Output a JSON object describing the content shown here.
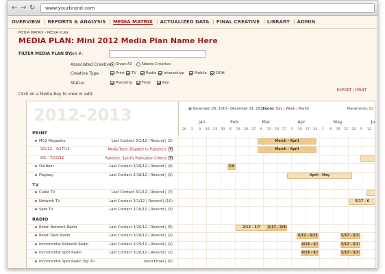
{
  "browser": {
    "url": "www.yourbrand.com",
    "back": "←",
    "forward": "→",
    "reload": "↻"
  },
  "nav": {
    "items": [
      "OVERVIEW",
      "REPORTS & ANALYSIS",
      "MEDIA MATRIX",
      "ACTUALIZED DATA",
      "FINAL CREATIVE",
      "LIBRARY",
      "ADMIN"
    ],
    "active": "MEDIA MATRIX"
  },
  "breadcrumb": "MEDIA MATRIX  ›  MEDIA PLAN",
  "title": "MEDIA PLAN: Mini 2012 Media Plan Name Here",
  "filter": {
    "label": "FILTER MEDIA PLAN BY:",
    "job_label": "Job #:",
    "job_value": "",
    "assoc_label": "Associated Creative:",
    "assoc_options": [
      {
        "label": "Show All",
        "selected": true
      },
      {
        "label": "Needs Creative",
        "selected": false
      }
    ],
    "type_label": "Creative Type:",
    "type_options": [
      {
        "label": "Print",
        "checked": true
      },
      {
        "label": "TV",
        "checked": true
      },
      {
        "label": "Radio",
        "checked": true
      },
      {
        "label": "Interactive",
        "checked": true
      },
      {
        "label": "Mobile",
        "checked": true
      },
      {
        "label": "OOH",
        "checked": true
      }
    ],
    "status_label": "Status:",
    "status_options": [
      {
        "label": "Planning",
        "checked": true
      },
      {
        "label": "Final",
        "checked": true
      },
      {
        "label": "Run",
        "checked": true
      }
    ]
  },
  "hint": "Click on a Media Buy to view or edit.",
  "actions": {
    "export": "EXPORT",
    "sep": "|",
    "print": "PRINT"
  },
  "plan": {
    "year": "2012-2013",
    "date_range": "December 26, 2010 - December 31, 2011",
    "zoom_label": "Zoom:",
    "zoom_options": [
      "Day",
      "Week",
      "Month"
    ],
    "placements_label": "Placements:",
    "months": [
      "Jan",
      "Feb",
      "Mar",
      "Apr",
      "May",
      "Jun"
    ],
    "weeks": [
      "26",
      "2",
      "9",
      "16",
      "23",
      "30",
      "6",
      "13",
      "20",
      "27",
      "6",
      "13",
      "20",
      "27",
      "3",
      "10",
      "17",
      "24",
      "1",
      "8",
      "15",
      "22",
      "29",
      "5",
      "12"
    ],
    "sections": [
      {
        "name": "PRINT",
        "rows": [
          {
            "name": "MC2 Magazine",
            "last": "Last Contact 3/1/12  |  Resend  |  (2)",
            "bars": [
              {
                "label": "March - April",
                "start": 0.4,
                "end": 0.7,
                "dark": true
              }
            ]
          },
          {
            "name": "3/1/12 - 4/27/12",
            "sub": true,
            "task": "Media Team: Dispatch to Publishers",
            "bars": [
              {
                "label": "March - April",
                "start": 0.4,
                "end": 0.7,
                "dark": true
              }
            ]
          },
          {
            "name": "6/1 - 7/21/12",
            "sub": true,
            "task": "Publisher: Specify Publication Criteria",
            "bars": [
              {
                "label": "",
                "start": 0.92,
                "end": 1.0,
                "dark": false
              }
            ]
          },
          {
            "name": "Outdoor",
            "last": "Last Contact 3/20/12  |  Resend  |  (4)",
            "bars": [
              {
                "label": "2/6",
                "start": 0.25,
                "end": 0.29,
                "dark": true
              }
            ]
          },
          {
            "name": "Playboy",
            "last": "Last Contact 2/18/12  |  Resend  |  (3)",
            "bars": [
              {
                "label": "April - May",
                "start": 0.55,
                "end": 0.88,
                "dark": false
              }
            ]
          }
        ]
      },
      {
        "name": "TV",
        "rows": [
          {
            "name": "Cable TV",
            "last": "Last Contact 3/1/12  |  Resend  |  (7)",
            "bars": [
              {
                "label": "",
                "start": 0.95,
                "end": 1.0,
                "dark": false
              }
            ]
          },
          {
            "name": "Network TV",
            "last": "Last Contact 3/1/12  |  Resend  |  (10)",
            "bars": [
              {
                "label": "5/17 - 6",
                "start": 0.86,
                "end": 1.0,
                "dark": false
              }
            ]
          },
          {
            "name": "Spot TV",
            "last": "Last Contact 2/10/12  |  Resend  |  (3)",
            "bars": []
          }
        ]
      },
      {
        "name": "RADIO",
        "rows": [
          {
            "name": "Retail Network Radio",
            "last": "Last Contact 3/20/12  |  Resend  |  (5)",
            "bars": [
              {
                "label": "2/12 - 3/7",
                "start": 0.29,
                "end": 0.45,
                "dark": false
              },
              {
                "label": "3/17 - 3/30",
                "start": 0.45,
                "end": 0.55,
                "dark": true
              }
            ]
          },
          {
            "name": "Retail Spot Radio",
            "last": "Last Contact 3/20/12  |  Resend  |  (2)",
            "bars": [
              {
                "label": "4/12 - 4/25",
                "start": 0.6,
                "end": 0.71,
                "dark": true
              },
              {
                "label": "5/17 - 5/31",
                "start": 0.82,
                "end": 0.92,
                "dark": true
              }
            ]
          },
          {
            "name": "Incremental Network Radio",
            "last": "Last Contact 2/29/12  |  Resend  |  (2)",
            "bars": [
              {
                "label": "4/19 - 4/30",
                "start": 0.62,
                "end": 0.71,
                "dark": true
              },
              {
                "label": "5/17 - 5/31",
                "start": 0.82,
                "end": 0.92,
                "dark": true
              }
            ]
          },
          {
            "name": "Incremental Spot Radio",
            "last": "Last Contact 3/20/12  |  Resend  |  (1)",
            "bars": [
              {
                "label": "4/19 - 4/30",
                "start": 0.62,
                "end": 0.71,
                "dark": true
              },
              {
                "label": "5/17 - 5/31",
                "start": 0.82,
                "end": 0.92,
                "dark": true
              }
            ]
          },
          {
            "name": "Incremental Spot Radio Top 20",
            "last": "Send Email  |  (0)",
            "bars": []
          }
        ]
      }
    ]
  }
}
